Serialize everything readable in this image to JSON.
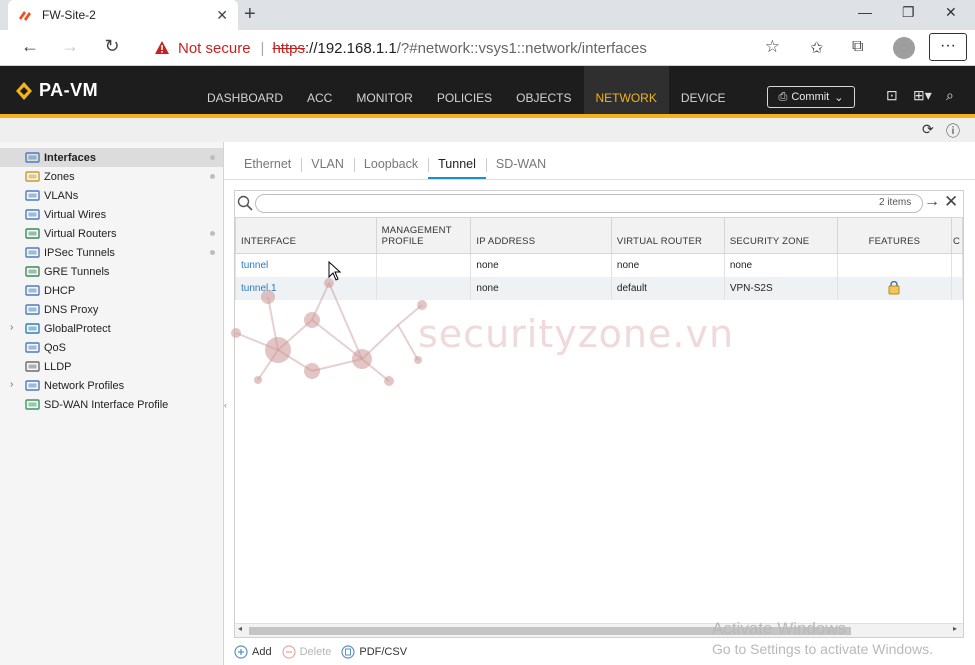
{
  "browser": {
    "tab_title": "FW-Site-2",
    "not_secure": "Not secure",
    "url_scheme": "https",
    "url_host": "://192.168.1.1",
    "url_rest": "/?#network::vsys1::network/interfaces",
    "more_label": "···"
  },
  "header": {
    "product": "PA-VM",
    "nav": [
      "DASHBOARD",
      "ACC",
      "MONITOR",
      "POLICIES",
      "OBJECTS",
      "NETWORK",
      "DEVICE"
    ],
    "active_nav": "NETWORK",
    "commit_label": "Commit"
  },
  "sidebar": {
    "items": [
      {
        "label": "Interfaces",
        "icon": "interface-icon",
        "selected": true,
        "dot": true
      },
      {
        "label": "Zones",
        "icon": "zone-icon",
        "dot": true
      },
      {
        "label": "VLANs",
        "icon": "vlan-icon"
      },
      {
        "label": "Virtual Wires",
        "icon": "virtual-wire-icon"
      },
      {
        "label": "Virtual Routers",
        "icon": "router-icon",
        "dot": true
      },
      {
        "label": "IPSec Tunnels",
        "icon": "ipsec-icon",
        "dot": true
      },
      {
        "label": "GRE Tunnels",
        "icon": "gre-icon"
      },
      {
        "label": "DHCP",
        "icon": "dhcp-icon"
      },
      {
        "label": "DNS Proxy",
        "icon": "dns-icon"
      },
      {
        "label": "GlobalProtect",
        "icon": "globalprotect-icon",
        "caret": true
      },
      {
        "label": "QoS",
        "icon": "qos-icon"
      },
      {
        "label": "LLDP",
        "icon": "lldp-icon"
      },
      {
        "label": "Network Profiles",
        "icon": "profiles-icon",
        "caret": true
      },
      {
        "label": "SD-WAN Interface Profile",
        "icon": "sdwan-icon"
      }
    ]
  },
  "tabs": [
    "Ethernet",
    "VLAN",
    "Loopback",
    "Tunnel",
    "SD-WAN"
  ],
  "active_tab": "Tunnel",
  "search": {
    "placeholder": "",
    "count": "2 items"
  },
  "table": {
    "columns": [
      "INTERFACE",
      "MANAGEMENT PROFILE",
      "IP ADDRESS",
      "VIRTUAL ROUTER",
      "SECURITY ZONE",
      "FEATURES",
      "C"
    ],
    "rows": [
      {
        "interface": "tunnel",
        "mgmt": "",
        "ip": "none",
        "router": "none",
        "zone": "none",
        "features": false
      },
      {
        "interface": "tunnel.1",
        "mgmt": "",
        "ip": "none",
        "router": "default",
        "zone": "VPN-S2S",
        "features": true
      }
    ]
  },
  "bottom": {
    "add": "Add",
    "delete": "Delete",
    "pdf": "PDF/CSV"
  },
  "watermark": "securityzone.vn",
  "activate": {
    "line1": "Activate Windows",
    "line2": "Go to Settings to activate Windows."
  },
  "colors": {
    "accent": "#f3b31b",
    "link": "#2a78c2",
    "header_bg": "#1d1d1d"
  }
}
